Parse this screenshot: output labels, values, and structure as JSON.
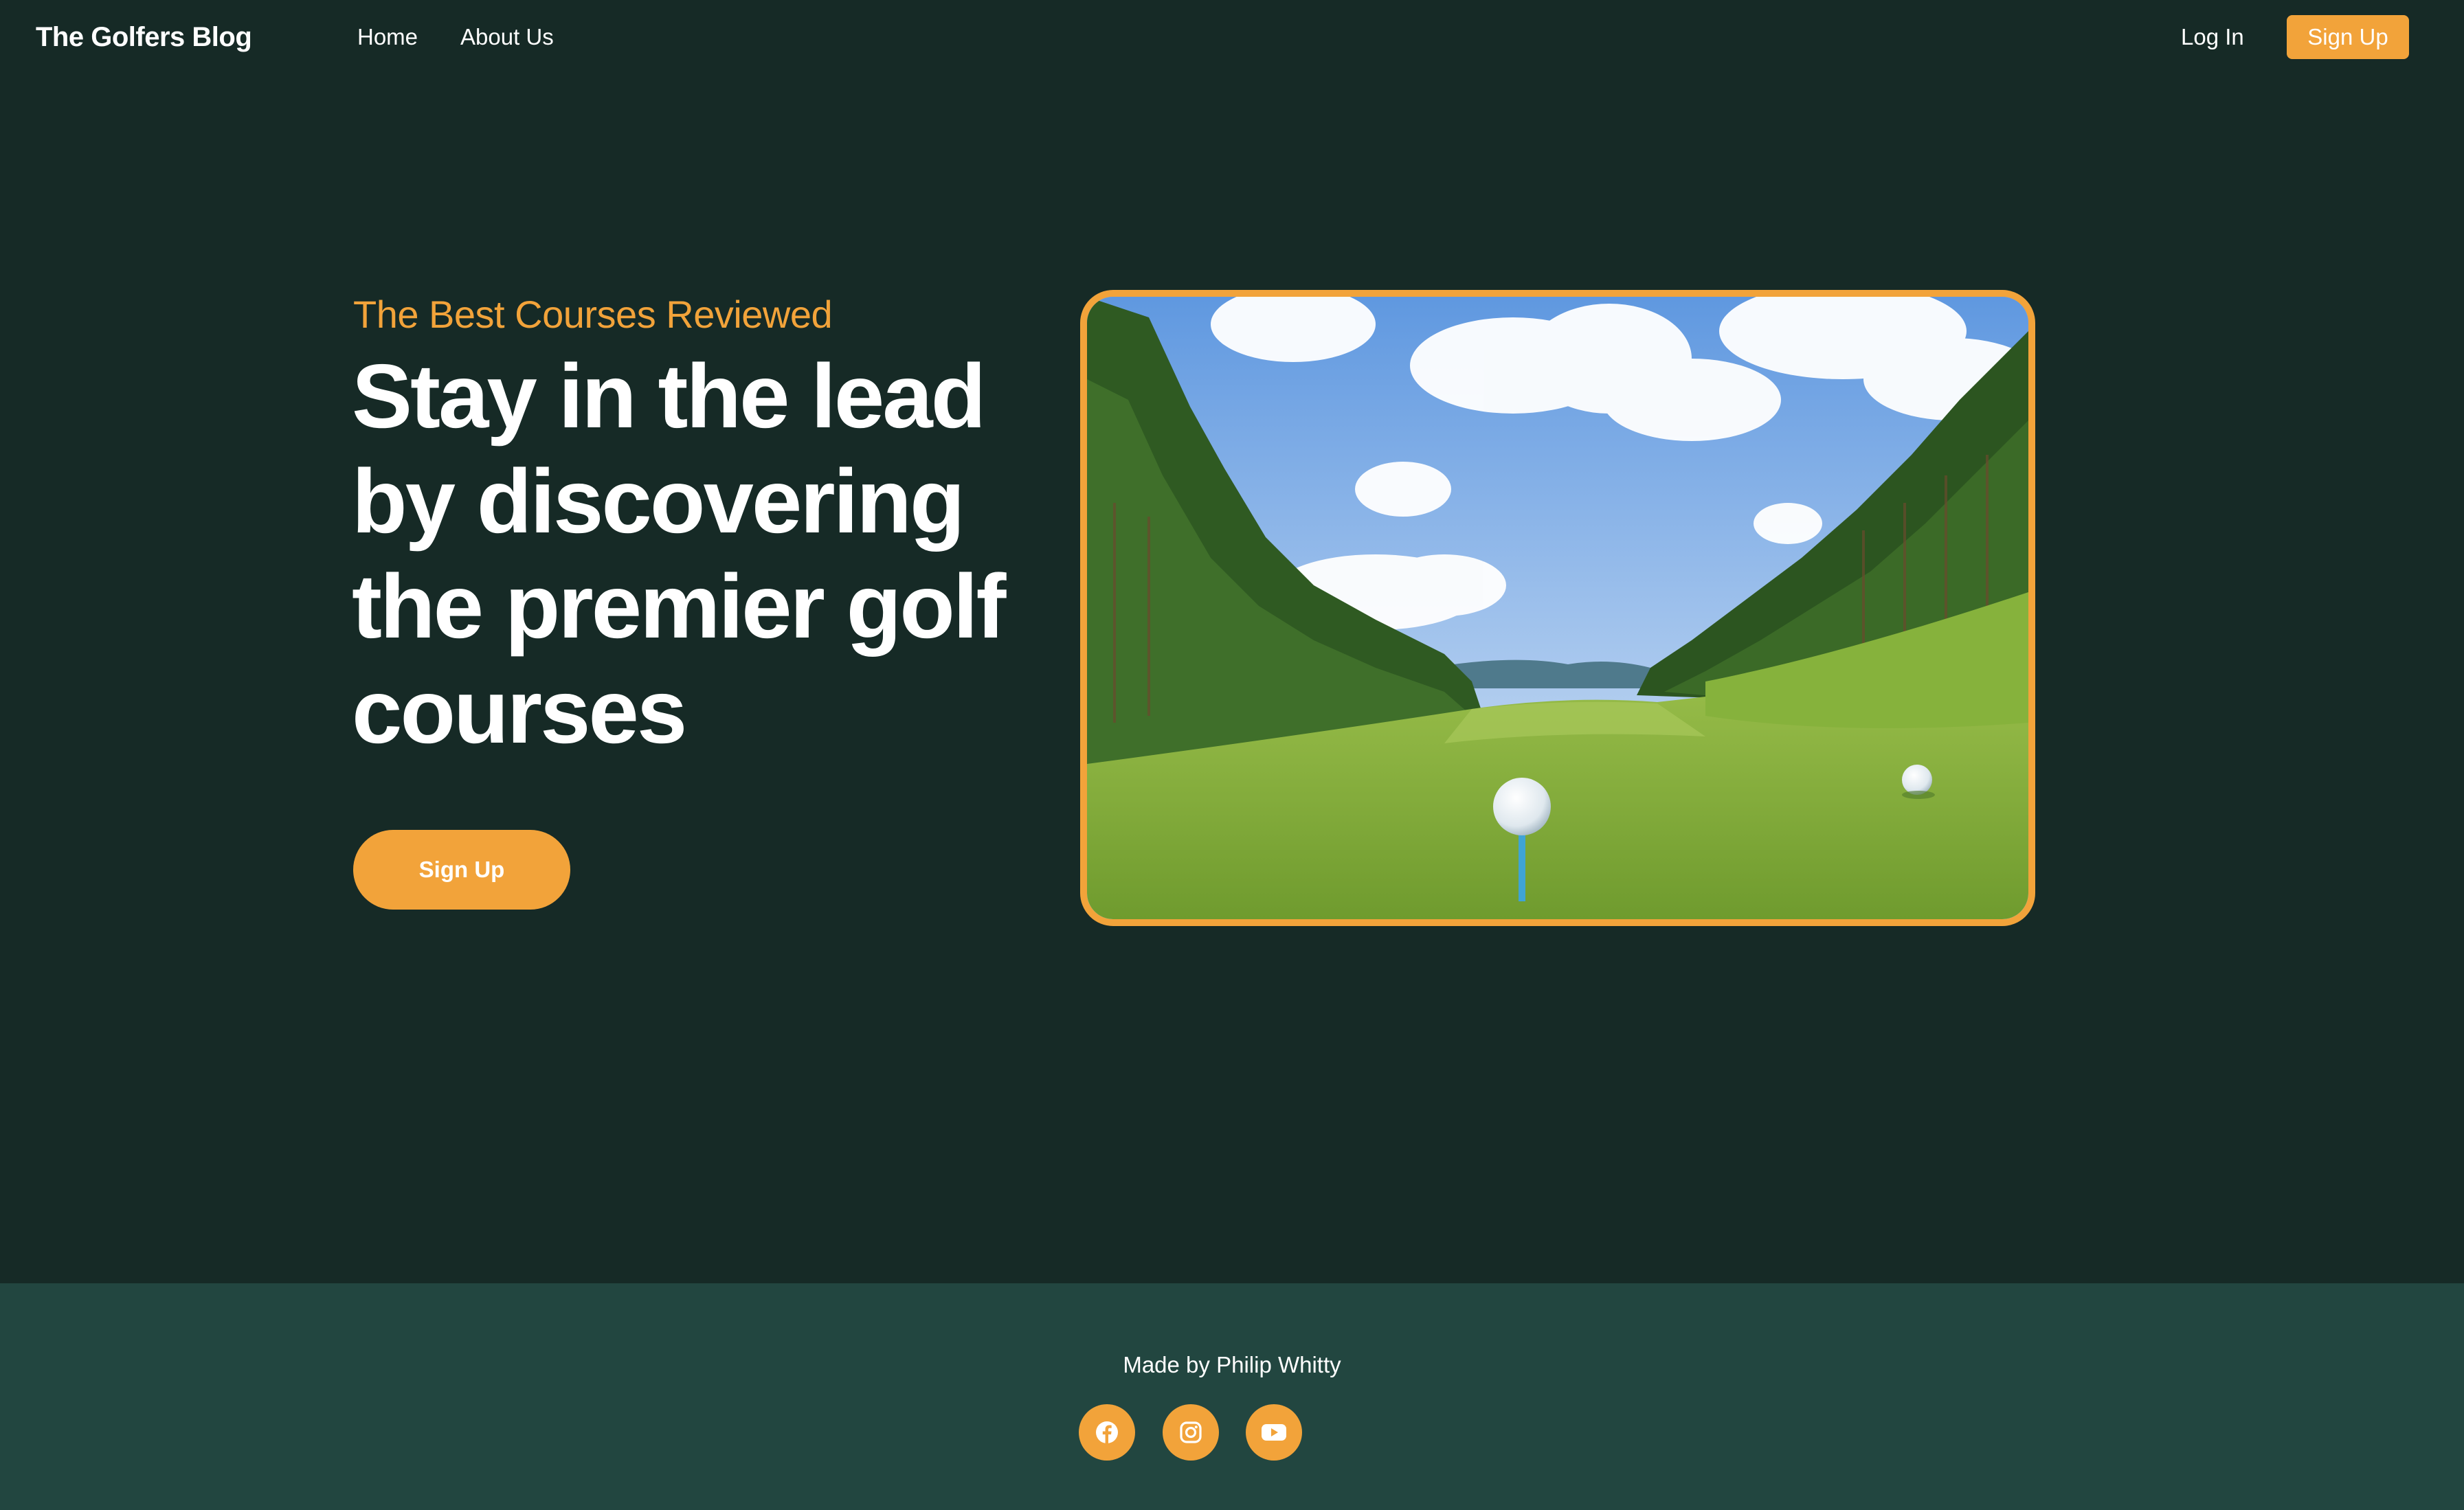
{
  "nav": {
    "brand": "The Golfers Blog",
    "links": [
      "Home",
      "About Us"
    ],
    "login_label": "Log In",
    "signup_label": "Sign Up"
  },
  "hero": {
    "eyebrow": "The Best Courses Reviewed",
    "headline": "Stay in the lead by discovering the premier golf courses",
    "cta_label": "Sign Up",
    "image_icon": "golf-course-photo"
  },
  "footer": {
    "credit": "Made by Philip Whitty",
    "socials": [
      {
        "icon": "facebook-icon"
      },
      {
        "icon": "instagram-icon"
      },
      {
        "icon": "youtube-icon"
      }
    ]
  },
  "colors": {
    "background": "#162a26",
    "footer_background": "#224640",
    "accent": "#f2a33a",
    "text": "#ffffff"
  }
}
